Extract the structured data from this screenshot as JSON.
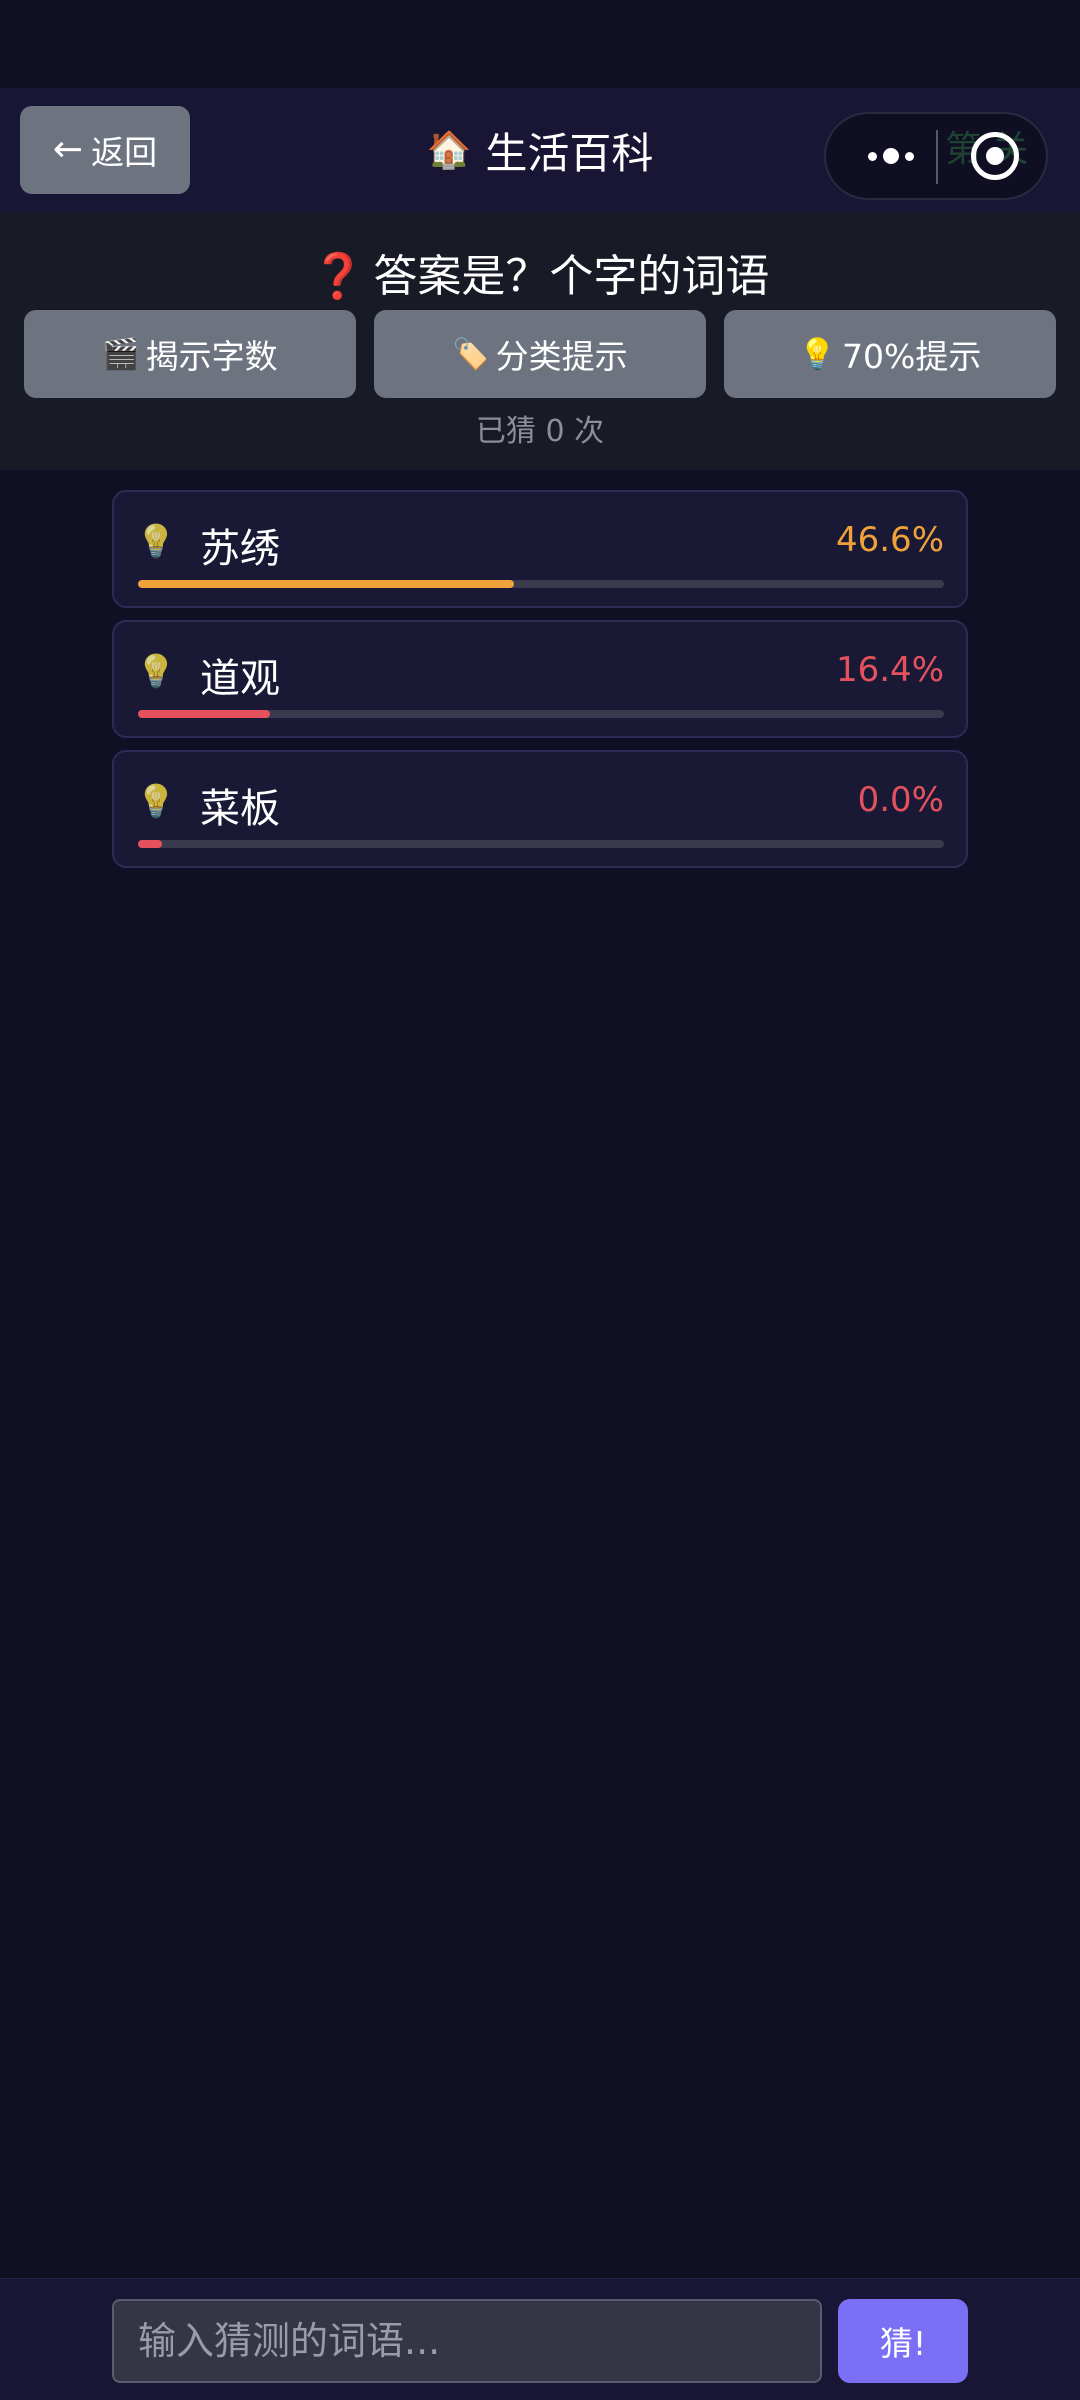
{
  "nav": {
    "back_arrow": "←",
    "back_label": "返回",
    "title_icon": "🏠",
    "title": "生活百科",
    "level_label": "第 关"
  },
  "hint_panel": {
    "question_mark": "❓",
    "question": "答案是？个字的词语",
    "buttons": [
      {
        "icon": "🎬",
        "label": "揭示字数"
      },
      {
        "icon": "🏷️",
        "label": "分类提示"
      },
      {
        "icon": "💡",
        "label": "70%提示"
      }
    ],
    "guess_count": "已猜 0 次"
  },
  "guesses": [
    {
      "icon": "💡",
      "word": "苏绣",
      "percent_text": "46.6%",
      "similarity": 0.466,
      "color": "#f0a13a"
    },
    {
      "icon": "💡",
      "word": "道观",
      "percent_text": "16.4%",
      "similarity": 0.164,
      "color": "#e5525e"
    },
    {
      "icon": "💡",
      "word": "菜板",
      "percent_text": "0.0%",
      "similarity": 0.0,
      "color": "#e5525e"
    }
  ],
  "input": {
    "placeholder": "输入猜测的词语...",
    "value": ""
  },
  "submit_label": "猜!",
  "colors": {
    "background": "#100f23",
    "accent": "#7b6ff5",
    "button_gray": "#6d7480"
  }
}
